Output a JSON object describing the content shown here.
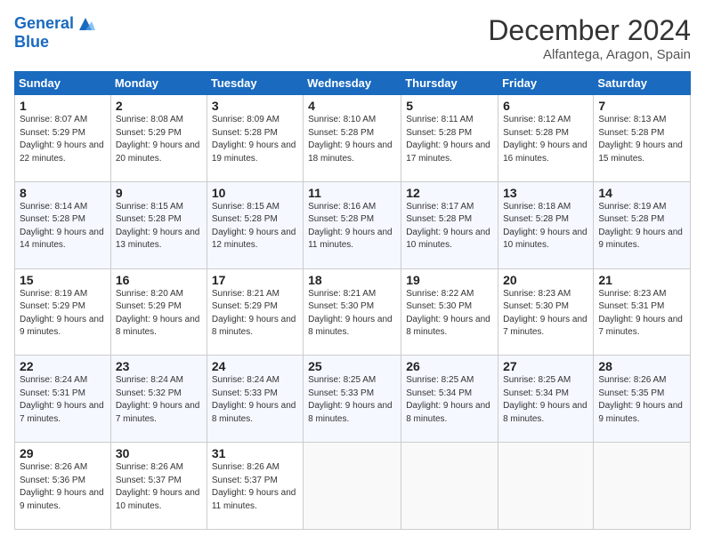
{
  "header": {
    "logo_line1": "General",
    "logo_line2": "Blue",
    "title": "December 2024",
    "location": "Alfantega, Aragon, Spain"
  },
  "days_of_week": [
    "Sunday",
    "Monday",
    "Tuesday",
    "Wednesday",
    "Thursday",
    "Friday",
    "Saturday"
  ],
  "weeks": [
    [
      {
        "day": "1",
        "sunrise": "8:07 AM",
        "sunset": "5:29 PM",
        "daylight": "9 hours and 22 minutes."
      },
      {
        "day": "2",
        "sunrise": "8:08 AM",
        "sunset": "5:29 PM",
        "daylight": "9 hours and 20 minutes."
      },
      {
        "day": "3",
        "sunrise": "8:09 AM",
        "sunset": "5:28 PM",
        "daylight": "9 hours and 19 minutes."
      },
      {
        "day": "4",
        "sunrise": "8:10 AM",
        "sunset": "5:28 PM",
        "daylight": "9 hours and 18 minutes."
      },
      {
        "day": "5",
        "sunrise": "8:11 AM",
        "sunset": "5:28 PM",
        "daylight": "9 hours and 17 minutes."
      },
      {
        "day": "6",
        "sunrise": "8:12 AM",
        "sunset": "5:28 PM",
        "daylight": "9 hours and 16 minutes."
      },
      {
        "day": "7",
        "sunrise": "8:13 AM",
        "sunset": "5:28 PM",
        "daylight": "9 hours and 15 minutes."
      }
    ],
    [
      {
        "day": "8",
        "sunrise": "8:14 AM",
        "sunset": "5:28 PM",
        "daylight": "9 hours and 14 minutes."
      },
      {
        "day": "9",
        "sunrise": "8:15 AM",
        "sunset": "5:28 PM",
        "daylight": "9 hours and 13 minutes."
      },
      {
        "day": "10",
        "sunrise": "8:15 AM",
        "sunset": "5:28 PM",
        "daylight": "9 hours and 12 minutes."
      },
      {
        "day": "11",
        "sunrise": "8:16 AM",
        "sunset": "5:28 PM",
        "daylight": "9 hours and 11 minutes."
      },
      {
        "day": "12",
        "sunrise": "8:17 AM",
        "sunset": "5:28 PM",
        "daylight": "9 hours and 10 minutes."
      },
      {
        "day": "13",
        "sunrise": "8:18 AM",
        "sunset": "5:28 PM",
        "daylight": "9 hours and 10 minutes."
      },
      {
        "day": "14",
        "sunrise": "8:19 AM",
        "sunset": "5:28 PM",
        "daylight": "9 hours and 9 minutes."
      }
    ],
    [
      {
        "day": "15",
        "sunrise": "8:19 AM",
        "sunset": "5:29 PM",
        "daylight": "9 hours and 9 minutes."
      },
      {
        "day": "16",
        "sunrise": "8:20 AM",
        "sunset": "5:29 PM",
        "daylight": "9 hours and 8 minutes."
      },
      {
        "day": "17",
        "sunrise": "8:21 AM",
        "sunset": "5:29 PM",
        "daylight": "9 hours and 8 minutes."
      },
      {
        "day": "18",
        "sunrise": "8:21 AM",
        "sunset": "5:30 PM",
        "daylight": "9 hours and 8 minutes."
      },
      {
        "day": "19",
        "sunrise": "8:22 AM",
        "sunset": "5:30 PM",
        "daylight": "9 hours and 8 minutes."
      },
      {
        "day": "20",
        "sunrise": "8:23 AM",
        "sunset": "5:30 PM",
        "daylight": "9 hours and 7 minutes."
      },
      {
        "day": "21",
        "sunrise": "8:23 AM",
        "sunset": "5:31 PM",
        "daylight": "9 hours and 7 minutes."
      }
    ],
    [
      {
        "day": "22",
        "sunrise": "8:24 AM",
        "sunset": "5:31 PM",
        "daylight": "9 hours and 7 minutes."
      },
      {
        "day": "23",
        "sunrise": "8:24 AM",
        "sunset": "5:32 PM",
        "daylight": "9 hours and 7 minutes."
      },
      {
        "day": "24",
        "sunrise": "8:24 AM",
        "sunset": "5:33 PM",
        "daylight": "9 hours and 8 minutes."
      },
      {
        "day": "25",
        "sunrise": "8:25 AM",
        "sunset": "5:33 PM",
        "daylight": "9 hours and 8 minutes."
      },
      {
        "day": "26",
        "sunrise": "8:25 AM",
        "sunset": "5:34 PM",
        "daylight": "9 hours and 8 minutes."
      },
      {
        "day": "27",
        "sunrise": "8:25 AM",
        "sunset": "5:34 PM",
        "daylight": "9 hours and 8 minutes."
      },
      {
        "day": "28",
        "sunrise": "8:26 AM",
        "sunset": "5:35 PM",
        "daylight": "9 hours and 9 minutes."
      }
    ],
    [
      {
        "day": "29",
        "sunrise": "8:26 AM",
        "sunset": "5:36 PM",
        "daylight": "9 hours and 9 minutes."
      },
      {
        "day": "30",
        "sunrise": "8:26 AM",
        "sunset": "5:37 PM",
        "daylight": "9 hours and 10 minutes."
      },
      {
        "day": "31",
        "sunrise": "8:26 AM",
        "sunset": "5:37 PM",
        "daylight": "9 hours and 11 minutes."
      },
      null,
      null,
      null,
      null
    ]
  ]
}
